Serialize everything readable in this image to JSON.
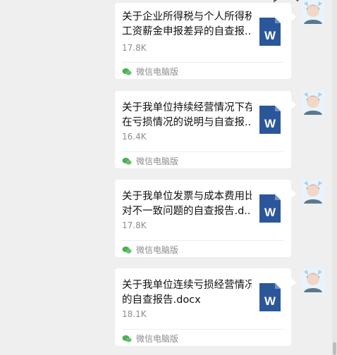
{
  "toolbar": {
    "icons": [
      "chat-bubble-icon",
      "checkmark-icon",
      "more-icon"
    ]
  },
  "messages": [
    {
      "file_name_line1": "关于企业所得税与个人所得税",
      "file_name_line2": "工资薪金申报差异的自查报...",
      "file_size": "17.8K",
      "source": "微信电脑版",
      "file_type_letter": "W"
    },
    {
      "file_name_line1": "关于我单位持续经营情况下存",
      "file_name_line2": "在亏损情况的说明与自查报...",
      "file_size": "16.4K",
      "source": "微信电脑版",
      "file_type_letter": "W"
    },
    {
      "file_name_line1": "关于我单位发票与成本费用比",
      "file_name_line2": "对不一致问题的自查报告.d...",
      "file_size": "17.8K",
      "source": "微信电脑版",
      "file_type_letter": "W"
    },
    {
      "file_name_line1": "关于我单位连续亏损经营情况",
      "file_name_line2": "的自查报告.docx",
      "file_size": "18.1K",
      "source": "微信电脑版",
      "file_type_letter": "W"
    }
  ],
  "colors": {
    "background": "#efefef",
    "card": "#ffffff",
    "word_blue": "#2b579a",
    "wechat_green": "#4caf50"
  }
}
